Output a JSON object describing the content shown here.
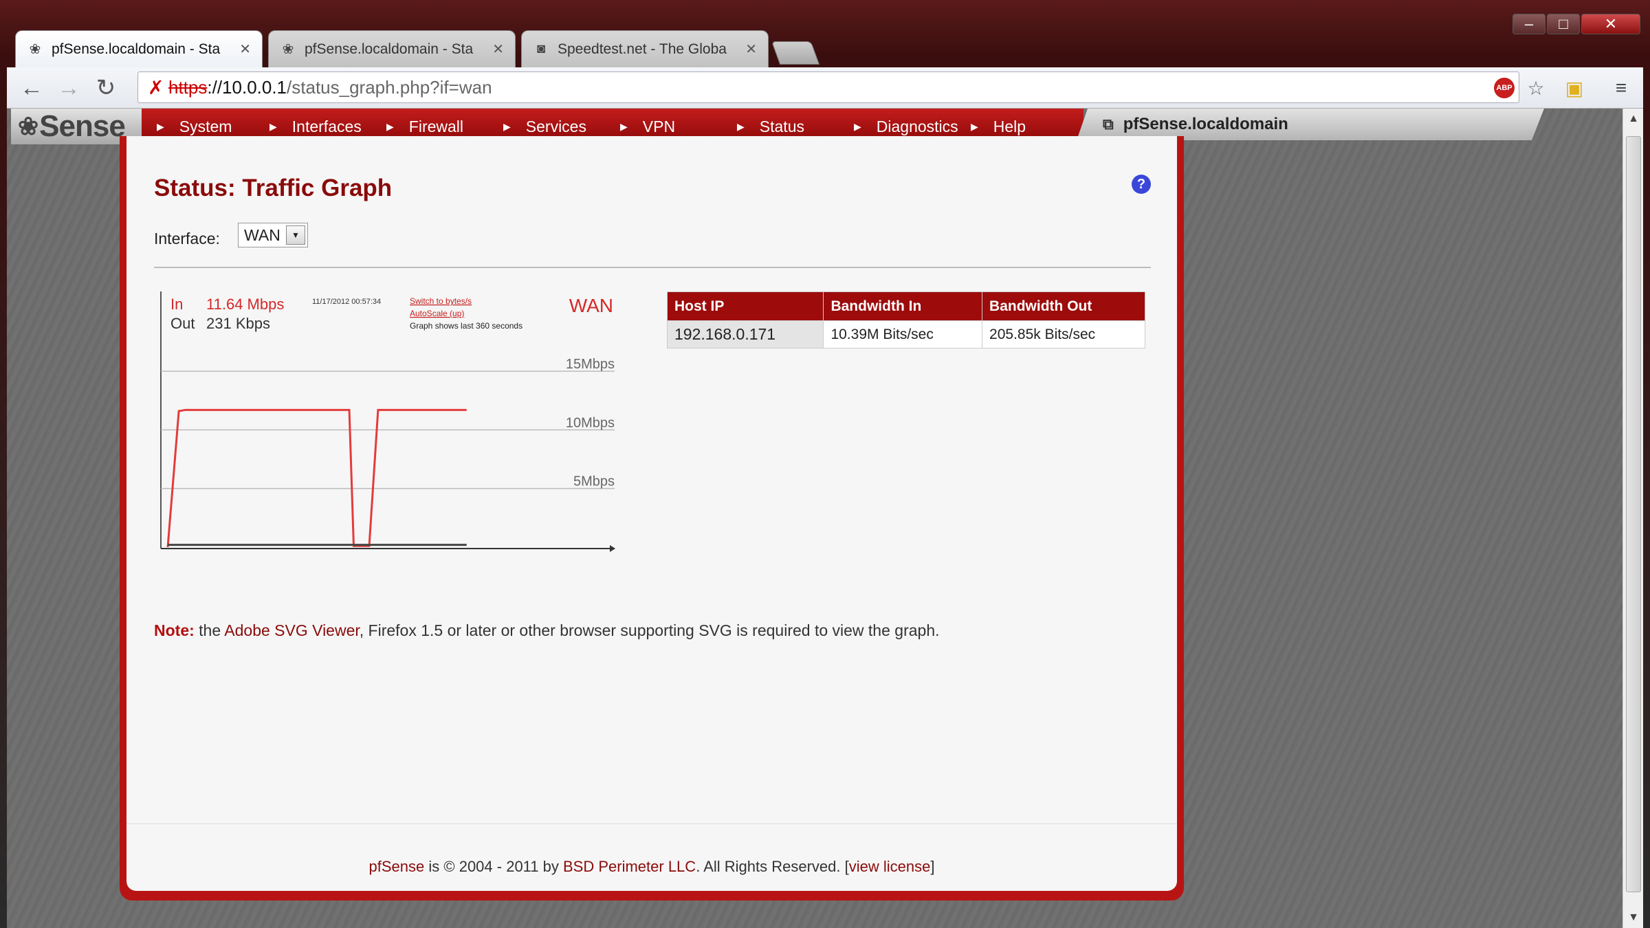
{
  "browser": {
    "tabs": [
      {
        "title": "pfSense.localdomain - Sta",
        "favicon": "pfsense-icon",
        "active": true
      },
      {
        "title": "pfSense.localdomain - Sta",
        "favicon": "pfsense-icon",
        "active": false
      },
      {
        "title": "Speedtest.net - The Globa",
        "favicon": "speedtest-icon",
        "active": false
      }
    ],
    "url": {
      "scheme": "https",
      "host": "://10.0.0.1",
      "path": "/status_graph.php?if=wan"
    },
    "extension_badge": "ABP"
  },
  "menu": {
    "logo": "Sense",
    "items": [
      "System",
      "Interfaces",
      "Firewall",
      "Services",
      "VPN",
      "Status",
      "Diagnostics",
      "Help"
    ],
    "hostname": "pfSense.localdomain"
  },
  "page": {
    "title": "Status: Traffic Graph",
    "interface_label": "Interface:",
    "interface_value": "WAN"
  },
  "graph": {
    "in_label": "In",
    "in_value": "11.64 Mbps",
    "out_label": "Out",
    "out_value": "231 Kbps",
    "timestamp": "11/17/2012 00:57:34",
    "switch_link": "Switch to bytes/s",
    "autoscale_link": "AutoScale (up)",
    "caption": "Graph shows last 360 seconds",
    "iface": "WAN",
    "grid_labels": [
      "15Mbps",
      "10Mbps",
      "5Mbps"
    ]
  },
  "chart_data": {
    "type": "line",
    "title": "",
    "xlabel": "",
    "ylabel": "",
    "ylim": [
      0,
      15
    ],
    "y_unit": "Mbps",
    "series": [
      {
        "color": "#e33b3b",
        "x": [
          0,
          5,
          8,
          82,
          84,
          91,
          95,
          135
        ],
        "values": [
          0,
          11.6,
          11.7,
          11.7,
          0.1,
          0.1,
          11.7,
          11.7
        ]
      },
      {
        "color": "#444444",
        "x": [
          0,
          135
        ],
        "values": [
          0.2,
          0.2
        ]
      }
    ]
  },
  "host_table": {
    "headers": [
      "Host IP",
      "Bandwidth In",
      "Bandwidth Out"
    ],
    "rows": [
      [
        "192.168.0.171",
        "10.39M Bits/sec",
        "205.85k Bits/sec"
      ]
    ]
  },
  "note": {
    "label": "Note:",
    "pre": "the",
    "link": "Adobe SVG Viewer",
    "post": ", Firefox 1.5 or later or other browser supporting SVG is required to view the graph."
  },
  "footer": {
    "brand": "pfSense",
    "mid": "is © 2004 - 2011 by",
    "company": "BSD Perimeter LLC",
    "rights": ". All Rights Reserved. [",
    "license": "view license",
    "close": "]"
  },
  "colors": {
    "brand_red": "#b81414",
    "header_red": "#9d0b0b",
    "line_red": "#e33b3b"
  }
}
